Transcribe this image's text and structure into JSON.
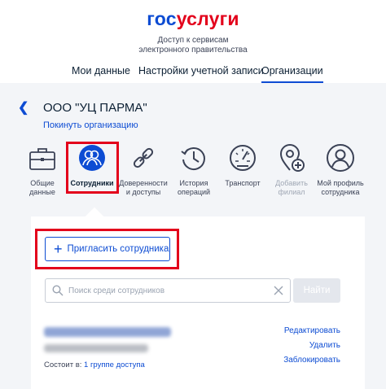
{
  "logo": {
    "part1": "гос",
    "part2": "услуги"
  },
  "tagline": {
    "line1": "Доступ к сервисам",
    "line2": "электронного правительства"
  },
  "tabs": [
    {
      "label": "Мои данные",
      "active": false
    },
    {
      "label": "Настройки учетной записи",
      "active": false
    },
    {
      "label": "Организации",
      "active": true
    }
  ],
  "org": {
    "title": "ООО \"УЦ ПАРМА\"",
    "leave_link": "Покинуть организацию"
  },
  "nav": [
    {
      "line1": "Общие",
      "line2": "данные",
      "icon": "briefcase-icon",
      "active": false,
      "disabled": false
    },
    {
      "line1": "Сотрудники",
      "line2": "",
      "icon": "employees-icon",
      "active": true,
      "disabled": false
    },
    {
      "line1": "Доверенности",
      "line2": "и доступы",
      "icon": "link-icon",
      "active": false,
      "disabled": false
    },
    {
      "line1": "История",
      "line2": "операций",
      "icon": "history-icon",
      "active": false,
      "disabled": false
    },
    {
      "line1": "Транспорт",
      "line2": "",
      "icon": "speedometer-icon",
      "active": false,
      "disabled": false
    },
    {
      "line1": "Добавить",
      "line2": "филиал",
      "icon": "add-location-icon",
      "active": false,
      "disabled": true
    },
    {
      "line1": "Мой профиль",
      "line2": "сотрудника",
      "icon": "profile-icon",
      "active": false,
      "disabled": false
    }
  ],
  "invite_button": {
    "label": "Пригласить сотрудника"
  },
  "search": {
    "placeholder": "Поиск среди сотрудников",
    "value": "",
    "button": "Найти"
  },
  "employee": {
    "groups_prefix": "Состоит в: ",
    "groups_link": "1 группе доступа",
    "actions": {
      "edit": "Редактировать",
      "delete": "Удалить",
      "block": "Заблокировать"
    }
  },
  "colors": {
    "brand_blue": "#0d4cd3",
    "brand_red": "#e3001b",
    "highlight": "#e3001b"
  }
}
